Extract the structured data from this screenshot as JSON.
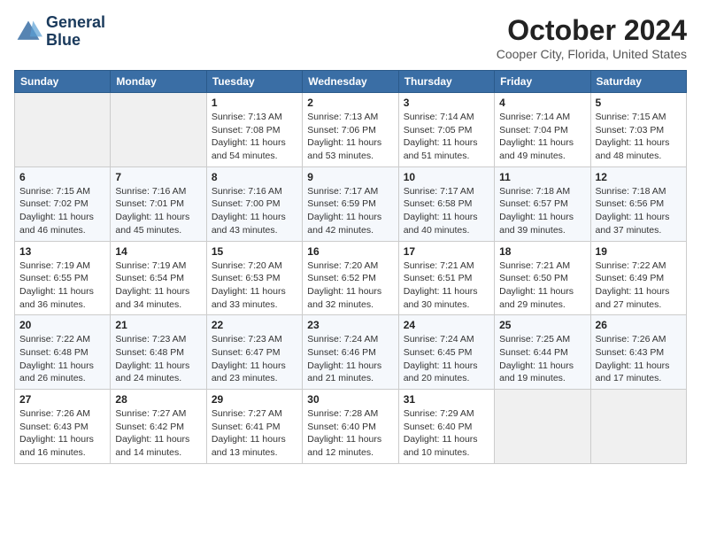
{
  "header": {
    "logo_line1": "General",
    "logo_line2": "Blue",
    "month": "October 2024",
    "location": "Cooper City, Florida, United States"
  },
  "weekdays": [
    "Sunday",
    "Monday",
    "Tuesday",
    "Wednesday",
    "Thursday",
    "Friday",
    "Saturday"
  ],
  "weeks": [
    [
      {
        "day": "",
        "info": ""
      },
      {
        "day": "",
        "info": ""
      },
      {
        "day": "1",
        "info": "Sunrise: 7:13 AM\nSunset: 7:08 PM\nDaylight: 11 hours and 54 minutes."
      },
      {
        "day": "2",
        "info": "Sunrise: 7:13 AM\nSunset: 7:06 PM\nDaylight: 11 hours and 53 minutes."
      },
      {
        "day": "3",
        "info": "Sunrise: 7:14 AM\nSunset: 7:05 PM\nDaylight: 11 hours and 51 minutes."
      },
      {
        "day": "4",
        "info": "Sunrise: 7:14 AM\nSunset: 7:04 PM\nDaylight: 11 hours and 49 minutes."
      },
      {
        "day": "5",
        "info": "Sunrise: 7:15 AM\nSunset: 7:03 PM\nDaylight: 11 hours and 48 minutes."
      }
    ],
    [
      {
        "day": "6",
        "info": "Sunrise: 7:15 AM\nSunset: 7:02 PM\nDaylight: 11 hours and 46 minutes."
      },
      {
        "day": "7",
        "info": "Sunrise: 7:16 AM\nSunset: 7:01 PM\nDaylight: 11 hours and 45 minutes."
      },
      {
        "day": "8",
        "info": "Sunrise: 7:16 AM\nSunset: 7:00 PM\nDaylight: 11 hours and 43 minutes."
      },
      {
        "day": "9",
        "info": "Sunrise: 7:17 AM\nSunset: 6:59 PM\nDaylight: 11 hours and 42 minutes."
      },
      {
        "day": "10",
        "info": "Sunrise: 7:17 AM\nSunset: 6:58 PM\nDaylight: 11 hours and 40 minutes."
      },
      {
        "day": "11",
        "info": "Sunrise: 7:18 AM\nSunset: 6:57 PM\nDaylight: 11 hours and 39 minutes."
      },
      {
        "day": "12",
        "info": "Sunrise: 7:18 AM\nSunset: 6:56 PM\nDaylight: 11 hours and 37 minutes."
      }
    ],
    [
      {
        "day": "13",
        "info": "Sunrise: 7:19 AM\nSunset: 6:55 PM\nDaylight: 11 hours and 36 minutes."
      },
      {
        "day": "14",
        "info": "Sunrise: 7:19 AM\nSunset: 6:54 PM\nDaylight: 11 hours and 34 minutes."
      },
      {
        "day": "15",
        "info": "Sunrise: 7:20 AM\nSunset: 6:53 PM\nDaylight: 11 hours and 33 minutes."
      },
      {
        "day": "16",
        "info": "Sunrise: 7:20 AM\nSunset: 6:52 PM\nDaylight: 11 hours and 32 minutes."
      },
      {
        "day": "17",
        "info": "Sunrise: 7:21 AM\nSunset: 6:51 PM\nDaylight: 11 hours and 30 minutes."
      },
      {
        "day": "18",
        "info": "Sunrise: 7:21 AM\nSunset: 6:50 PM\nDaylight: 11 hours and 29 minutes."
      },
      {
        "day": "19",
        "info": "Sunrise: 7:22 AM\nSunset: 6:49 PM\nDaylight: 11 hours and 27 minutes."
      }
    ],
    [
      {
        "day": "20",
        "info": "Sunrise: 7:22 AM\nSunset: 6:48 PM\nDaylight: 11 hours and 26 minutes."
      },
      {
        "day": "21",
        "info": "Sunrise: 7:23 AM\nSunset: 6:48 PM\nDaylight: 11 hours and 24 minutes."
      },
      {
        "day": "22",
        "info": "Sunrise: 7:23 AM\nSunset: 6:47 PM\nDaylight: 11 hours and 23 minutes."
      },
      {
        "day": "23",
        "info": "Sunrise: 7:24 AM\nSunset: 6:46 PM\nDaylight: 11 hours and 21 minutes."
      },
      {
        "day": "24",
        "info": "Sunrise: 7:24 AM\nSunset: 6:45 PM\nDaylight: 11 hours and 20 minutes."
      },
      {
        "day": "25",
        "info": "Sunrise: 7:25 AM\nSunset: 6:44 PM\nDaylight: 11 hours and 19 minutes."
      },
      {
        "day": "26",
        "info": "Sunrise: 7:26 AM\nSunset: 6:43 PM\nDaylight: 11 hours and 17 minutes."
      }
    ],
    [
      {
        "day": "27",
        "info": "Sunrise: 7:26 AM\nSunset: 6:43 PM\nDaylight: 11 hours and 16 minutes."
      },
      {
        "day": "28",
        "info": "Sunrise: 7:27 AM\nSunset: 6:42 PM\nDaylight: 11 hours and 14 minutes."
      },
      {
        "day": "29",
        "info": "Sunrise: 7:27 AM\nSunset: 6:41 PM\nDaylight: 11 hours and 13 minutes."
      },
      {
        "day": "30",
        "info": "Sunrise: 7:28 AM\nSunset: 6:40 PM\nDaylight: 11 hours and 12 minutes."
      },
      {
        "day": "31",
        "info": "Sunrise: 7:29 AM\nSunset: 6:40 PM\nDaylight: 11 hours and 10 minutes."
      },
      {
        "day": "",
        "info": ""
      },
      {
        "day": "",
        "info": ""
      }
    ]
  ]
}
